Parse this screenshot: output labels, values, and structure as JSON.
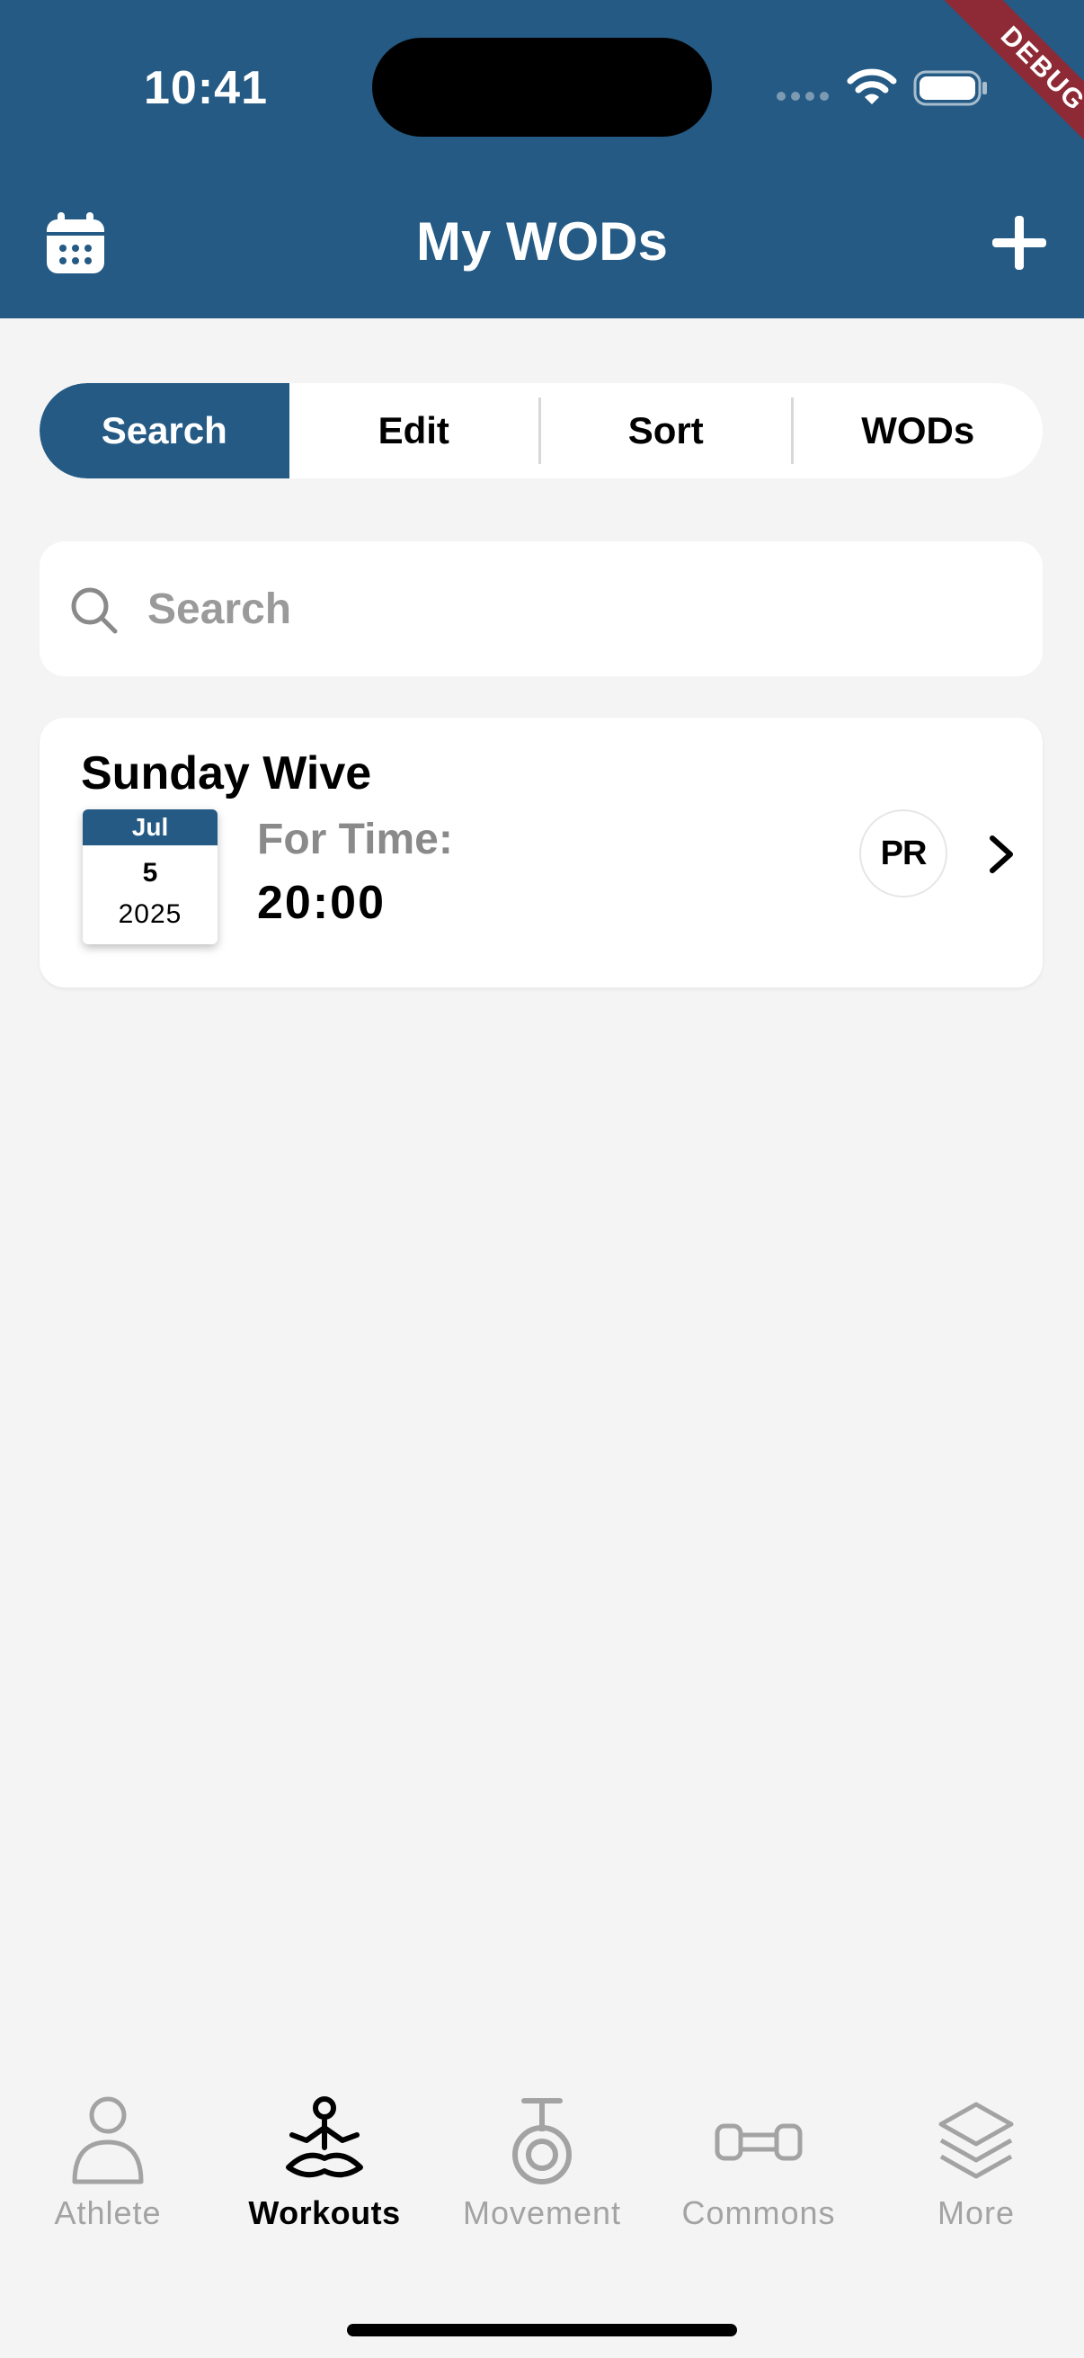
{
  "status_bar": {
    "time": "10:41"
  },
  "debug_banner": "DEBUG",
  "header": {
    "title": "My WODs"
  },
  "segments": [
    "Search",
    "Edit",
    "Sort",
    "WODs"
  ],
  "search": {
    "placeholder": "Search",
    "value": ""
  },
  "workouts": [
    {
      "title": "Sunday Wive",
      "date": {
        "month": "Jul",
        "day": "5",
        "year": "2025"
      },
      "type": "For Time:",
      "result": "20:00",
      "badge": "PR"
    }
  ],
  "nav": {
    "items": [
      {
        "label": "Athlete",
        "icon": "person-icon"
      },
      {
        "label": "Workouts",
        "icon": "meditation-icon"
      },
      {
        "label": "Movement",
        "icon": "kettlebell-icon"
      },
      {
        "label": "Commons",
        "icon": "dumbbell-icon"
      },
      {
        "label": "More",
        "icon": "layers-icon"
      }
    ],
    "active": "Workouts"
  },
  "colors": {
    "primary": "#245a84",
    "background": "#f4f4f4",
    "debug": "#8e2a36"
  }
}
